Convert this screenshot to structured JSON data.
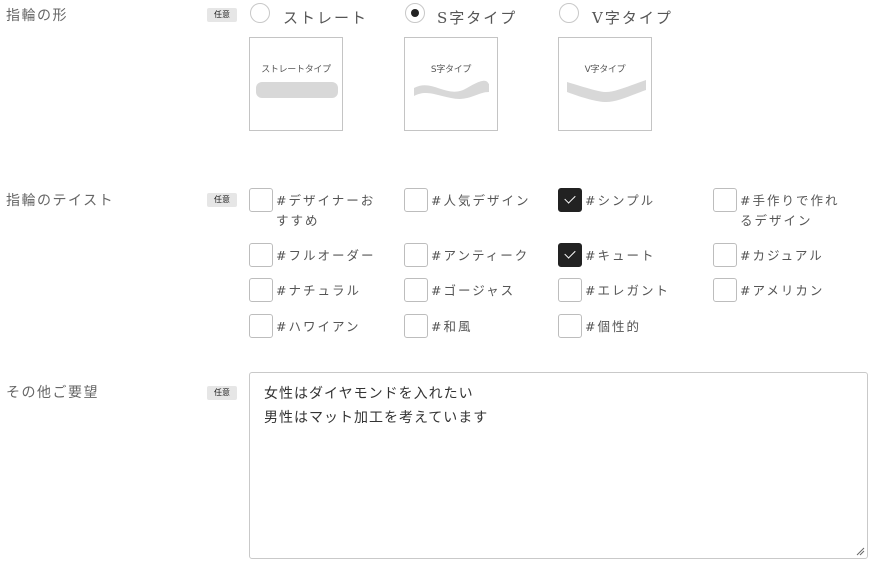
{
  "badge_text": "任意",
  "ring_shape": {
    "label": "指輪の形",
    "options": [
      {
        "label": "ストレート",
        "selected": false,
        "thumb_caption": "ストレートタイプ"
      },
      {
        "label": "S字タイプ",
        "selected": true,
        "thumb_caption": "S字タイプ"
      },
      {
        "label": "V字タイプ",
        "selected": false,
        "thumb_caption": "V字タイプ"
      }
    ]
  },
  "ring_taste": {
    "label": "指輪のテイスト",
    "options": [
      {
        "label": "#デザイナーおすすめ",
        "checked": false
      },
      {
        "label": "#人気デザイン",
        "checked": false
      },
      {
        "label": "#シンプル",
        "checked": true
      },
      {
        "label": "#手作りで作れるデザイン",
        "checked": false
      },
      {
        "label": "#フルオーダー",
        "checked": false
      },
      {
        "label": "#アンティーク",
        "checked": false
      },
      {
        "label": "#キュート",
        "checked": true
      },
      {
        "label": "#カジュアル",
        "checked": false
      },
      {
        "label": "#ナチュラル",
        "checked": false
      },
      {
        "label": "#ゴージャス",
        "checked": false
      },
      {
        "label": "#エレガント",
        "checked": false
      },
      {
        "label": "#アメリカン",
        "checked": false
      },
      {
        "label": "#ハワイアン",
        "checked": false
      },
      {
        "label": "#和風",
        "checked": false
      },
      {
        "label": "#個性的",
        "checked": false
      }
    ]
  },
  "other_requests": {
    "label": "その他ご要望",
    "value_line1": "女性はダイヤモンドを入れたい",
    "value_line2": "男性はマット加工を考えています"
  },
  "colors": {
    "accent": "#222222",
    "border": "#c4c4c4",
    "badge_bg": "#e6e6e6",
    "band_gray": "#d8d8d8"
  }
}
